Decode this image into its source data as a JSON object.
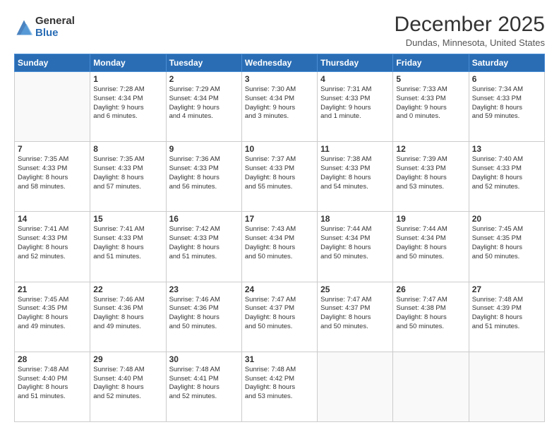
{
  "logo": {
    "general": "General",
    "blue": "Blue"
  },
  "header": {
    "month": "December 2025",
    "location": "Dundas, Minnesota, United States"
  },
  "days": [
    "Sunday",
    "Monday",
    "Tuesday",
    "Wednesday",
    "Thursday",
    "Friday",
    "Saturday"
  ],
  "weeks": [
    [
      {
        "day": "",
        "info": ""
      },
      {
        "day": "1",
        "info": "Sunrise: 7:28 AM\nSunset: 4:34 PM\nDaylight: 9 hours\nand 6 minutes."
      },
      {
        "day": "2",
        "info": "Sunrise: 7:29 AM\nSunset: 4:34 PM\nDaylight: 9 hours\nand 4 minutes."
      },
      {
        "day": "3",
        "info": "Sunrise: 7:30 AM\nSunset: 4:34 PM\nDaylight: 9 hours\nand 3 minutes."
      },
      {
        "day": "4",
        "info": "Sunrise: 7:31 AM\nSunset: 4:33 PM\nDaylight: 9 hours\nand 1 minute."
      },
      {
        "day": "5",
        "info": "Sunrise: 7:33 AM\nSunset: 4:33 PM\nDaylight: 9 hours\nand 0 minutes."
      },
      {
        "day": "6",
        "info": "Sunrise: 7:34 AM\nSunset: 4:33 PM\nDaylight: 8 hours\nand 59 minutes."
      }
    ],
    [
      {
        "day": "7",
        "info": "Sunrise: 7:35 AM\nSunset: 4:33 PM\nDaylight: 8 hours\nand 58 minutes."
      },
      {
        "day": "8",
        "info": "Sunrise: 7:35 AM\nSunset: 4:33 PM\nDaylight: 8 hours\nand 57 minutes."
      },
      {
        "day": "9",
        "info": "Sunrise: 7:36 AM\nSunset: 4:33 PM\nDaylight: 8 hours\nand 56 minutes."
      },
      {
        "day": "10",
        "info": "Sunrise: 7:37 AM\nSunset: 4:33 PM\nDaylight: 8 hours\nand 55 minutes."
      },
      {
        "day": "11",
        "info": "Sunrise: 7:38 AM\nSunset: 4:33 PM\nDaylight: 8 hours\nand 54 minutes."
      },
      {
        "day": "12",
        "info": "Sunrise: 7:39 AM\nSunset: 4:33 PM\nDaylight: 8 hours\nand 53 minutes."
      },
      {
        "day": "13",
        "info": "Sunrise: 7:40 AM\nSunset: 4:33 PM\nDaylight: 8 hours\nand 52 minutes."
      }
    ],
    [
      {
        "day": "14",
        "info": "Sunrise: 7:41 AM\nSunset: 4:33 PM\nDaylight: 8 hours\nand 52 minutes."
      },
      {
        "day": "15",
        "info": "Sunrise: 7:41 AM\nSunset: 4:33 PM\nDaylight: 8 hours\nand 51 minutes."
      },
      {
        "day": "16",
        "info": "Sunrise: 7:42 AM\nSunset: 4:33 PM\nDaylight: 8 hours\nand 51 minutes."
      },
      {
        "day": "17",
        "info": "Sunrise: 7:43 AM\nSunset: 4:34 PM\nDaylight: 8 hours\nand 50 minutes."
      },
      {
        "day": "18",
        "info": "Sunrise: 7:44 AM\nSunset: 4:34 PM\nDaylight: 8 hours\nand 50 minutes."
      },
      {
        "day": "19",
        "info": "Sunrise: 7:44 AM\nSunset: 4:34 PM\nDaylight: 8 hours\nand 50 minutes."
      },
      {
        "day": "20",
        "info": "Sunrise: 7:45 AM\nSunset: 4:35 PM\nDaylight: 8 hours\nand 50 minutes."
      }
    ],
    [
      {
        "day": "21",
        "info": "Sunrise: 7:45 AM\nSunset: 4:35 PM\nDaylight: 8 hours\nand 49 minutes."
      },
      {
        "day": "22",
        "info": "Sunrise: 7:46 AM\nSunset: 4:36 PM\nDaylight: 8 hours\nand 49 minutes."
      },
      {
        "day": "23",
        "info": "Sunrise: 7:46 AM\nSunset: 4:36 PM\nDaylight: 8 hours\nand 50 minutes."
      },
      {
        "day": "24",
        "info": "Sunrise: 7:47 AM\nSunset: 4:37 PM\nDaylight: 8 hours\nand 50 minutes."
      },
      {
        "day": "25",
        "info": "Sunrise: 7:47 AM\nSunset: 4:37 PM\nDaylight: 8 hours\nand 50 minutes."
      },
      {
        "day": "26",
        "info": "Sunrise: 7:47 AM\nSunset: 4:38 PM\nDaylight: 8 hours\nand 50 minutes."
      },
      {
        "day": "27",
        "info": "Sunrise: 7:48 AM\nSunset: 4:39 PM\nDaylight: 8 hours\nand 51 minutes."
      }
    ],
    [
      {
        "day": "28",
        "info": "Sunrise: 7:48 AM\nSunset: 4:40 PM\nDaylight: 8 hours\nand 51 minutes."
      },
      {
        "day": "29",
        "info": "Sunrise: 7:48 AM\nSunset: 4:40 PM\nDaylight: 8 hours\nand 52 minutes."
      },
      {
        "day": "30",
        "info": "Sunrise: 7:48 AM\nSunset: 4:41 PM\nDaylight: 8 hours\nand 52 minutes."
      },
      {
        "day": "31",
        "info": "Sunrise: 7:48 AM\nSunset: 4:42 PM\nDaylight: 8 hours\nand 53 minutes."
      },
      {
        "day": "",
        "info": ""
      },
      {
        "day": "",
        "info": ""
      },
      {
        "day": "",
        "info": ""
      }
    ]
  ]
}
